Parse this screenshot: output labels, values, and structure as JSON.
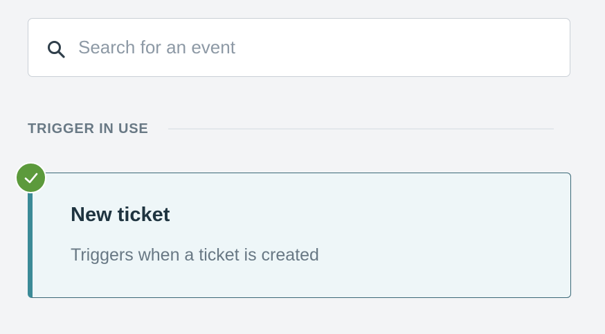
{
  "search": {
    "placeholder": "Search for an event",
    "value": "",
    "icon": "search-icon"
  },
  "section": {
    "title": "TRIGGER IN USE"
  },
  "trigger_card": {
    "title": "New ticket",
    "description": "Triggers when a ticket is created",
    "selected": true,
    "status_icon": "checkmark-icon"
  },
  "colors": {
    "background": "#f3f4f6",
    "card_background": "#eef6f8",
    "card_accent": "#3b8a97",
    "card_border": "#3b6877",
    "check_badge": "#5c9a3c",
    "title_text": "#1f3440",
    "muted_text": "#687884",
    "placeholder_text": "#8d99a5"
  }
}
